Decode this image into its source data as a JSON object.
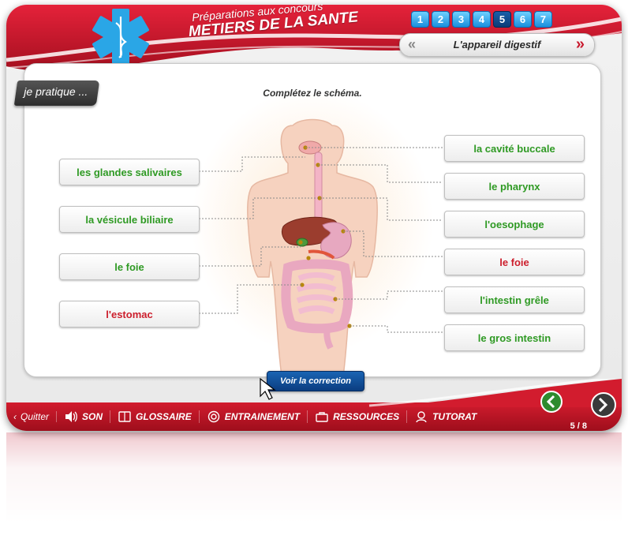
{
  "header": {
    "title_top": "Préparations aux concours",
    "title_main": "METIERS DE LA SANTE",
    "tabs": [
      "1",
      "2",
      "3",
      "4",
      "5",
      "6",
      "7"
    ],
    "active_tab": "5",
    "topic_title": "L'appareil digestif",
    "prev_symbol": "«",
    "next_symbol": "»"
  },
  "exercise": {
    "ribbon": "je pratique ...",
    "instruction": "Complétez le schéma.",
    "left_answers": [
      {
        "label": "les glandes salivaires",
        "status": "correct"
      },
      {
        "label": "la vésicule biliaire",
        "status": "correct"
      },
      {
        "label": "le foie",
        "status": "correct"
      },
      {
        "label": "l'estomac",
        "status": "incorrect"
      }
    ],
    "right_answers": [
      {
        "label": "la cavité buccale",
        "status": "correct"
      },
      {
        "label": "le pharynx",
        "status": "correct"
      },
      {
        "label": "l'oesophage",
        "status": "correct"
      },
      {
        "label": "le foie",
        "status": "incorrect"
      },
      {
        "label": "l'intestin grêle",
        "status": "correct"
      },
      {
        "label": "le gros intestin",
        "status": "correct"
      }
    ],
    "correction_button": "Voir la correction"
  },
  "footer": {
    "quit": "Quitter",
    "items": [
      "SON",
      "GLOSSAIRE",
      "ENTRAINEMENT",
      "RESSOURCES",
      "TUTORAT"
    ],
    "page_counter": "5 / 8"
  },
  "colors": {
    "brand_red": "#c81a2e",
    "tab_blue": "#1a8fdd",
    "correct_green": "#2f9a24",
    "incorrect_red": "#cc1e2c"
  }
}
